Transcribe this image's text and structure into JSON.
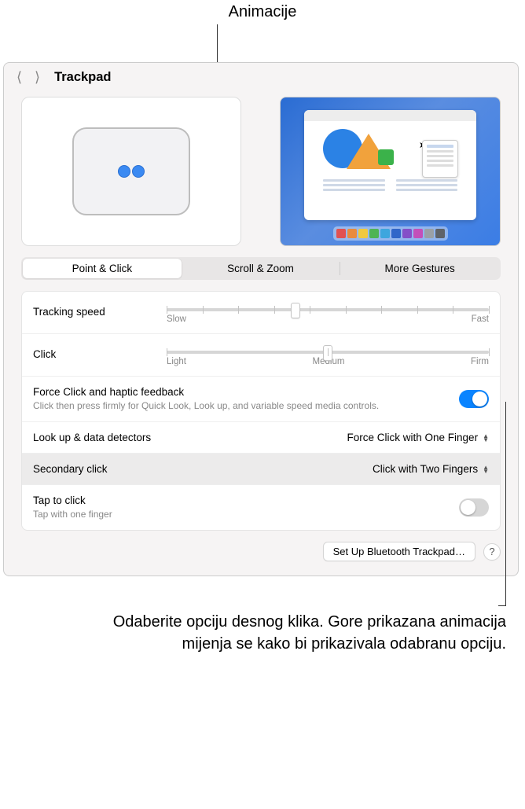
{
  "callouts": {
    "top": "Animacije",
    "bottom": "Odaberite opciju desnog klika. Gore prikazana animacija mijenja se kako bi prikazivala odabranu opciju."
  },
  "header": {
    "title": "Trackpad"
  },
  "tabs": {
    "point_click": "Point & Click",
    "scroll_zoom": "Scroll & Zoom",
    "more_gestures": "More Gestures"
  },
  "tracking": {
    "label": "Tracking speed",
    "min": "Slow",
    "max": "Fast"
  },
  "click": {
    "label": "Click",
    "min": "Light",
    "mid": "Medium",
    "max": "Firm"
  },
  "force_click": {
    "label": "Force Click and haptic feedback",
    "desc": "Click then press firmly for Quick Look, Look up, and variable speed media controls."
  },
  "lookup": {
    "label": "Look up & data detectors",
    "value": "Force Click with One Finger"
  },
  "secondary": {
    "label": "Secondary click",
    "value": "Click with Two Fingers"
  },
  "tap": {
    "label": "Tap to click",
    "desc": "Tap with one finger"
  },
  "footer": {
    "bt_button": "Set Up Bluetooth Trackpad…",
    "help": "?"
  },
  "dock_colors": [
    "#e25151",
    "#e98b3e",
    "#f0c93e",
    "#4fb455",
    "#3da6de",
    "#3066c9",
    "#8450c8",
    "#c350b9",
    "#9aa0a6",
    "#5f6368"
  ]
}
